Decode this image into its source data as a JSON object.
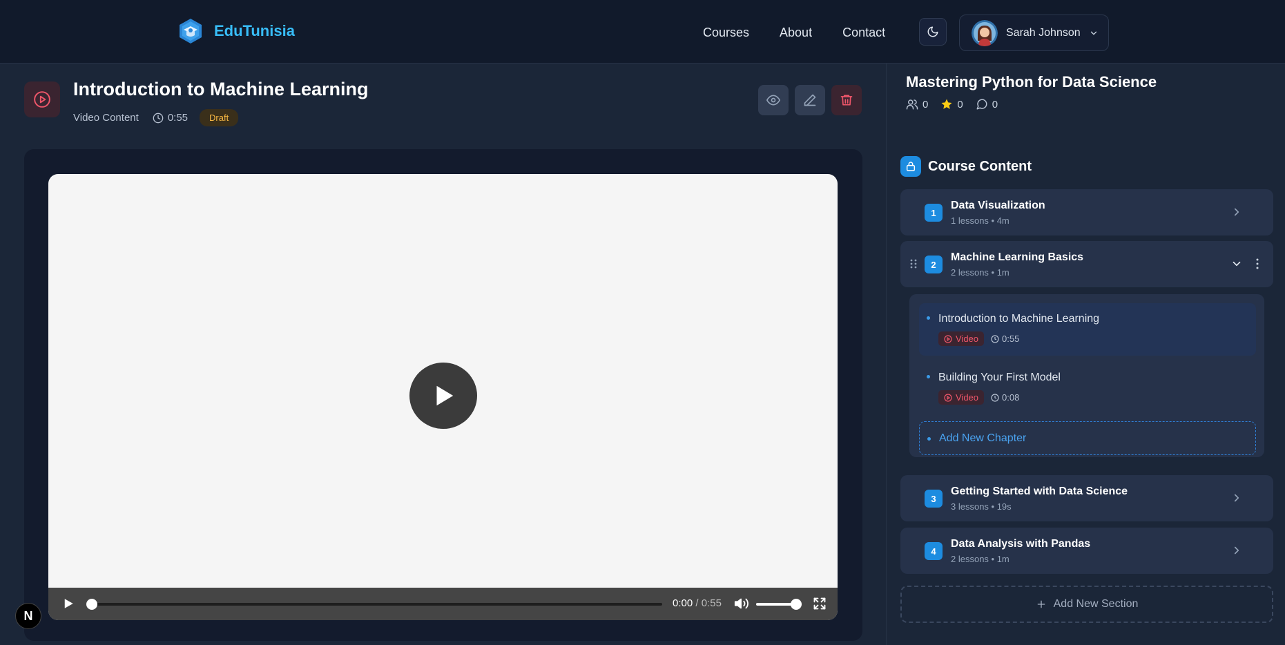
{
  "brand": {
    "name": "EduTunisia",
    "logo_icon": "graduation-cap-icon"
  },
  "nav": {
    "links": [
      "Courses",
      "About",
      "Contact"
    ]
  },
  "user": {
    "name": "Sarah Johnson"
  },
  "lesson": {
    "title": "Introduction to Machine Learning",
    "type": "Video Content",
    "duration": "0:55",
    "status": "Draft"
  },
  "player": {
    "current_time": "0:00",
    "separator": "/",
    "total_time": "0:55",
    "progress_percent": 0,
    "volume_percent": 100
  },
  "course": {
    "title": "Mastering Python for Data Science",
    "students": "0",
    "rating": "0",
    "comments": "0"
  },
  "content": {
    "heading": "Course Content",
    "sections": [
      {
        "number": "1",
        "title": "Data Visualization",
        "meta": "1 lessons • 4m"
      },
      {
        "number": "2",
        "title": "Machine Learning Basics",
        "meta": "2 lessons • 1m"
      },
      {
        "number": "3",
        "title": "Getting Started with Data Science",
        "meta": "3 lessons • 19s"
      },
      {
        "number": "4",
        "title": "Data Analysis with Pandas",
        "meta": "2 lessons • 1m"
      }
    ],
    "chapters": [
      {
        "title": "Introduction to Machine Learning",
        "type": "Video",
        "duration": "0:55"
      },
      {
        "title": "Building Your First Model",
        "type": "Video",
        "duration": "0:08"
      }
    ],
    "add_chapter_label": "Add New Chapter",
    "add_section_label": "Add New Section"
  },
  "dev_badge": "N",
  "colors": {
    "accent": "#1d8ce0",
    "brand": "#38bdf8",
    "danger": "#f0566a",
    "draft": "#f5b642"
  }
}
